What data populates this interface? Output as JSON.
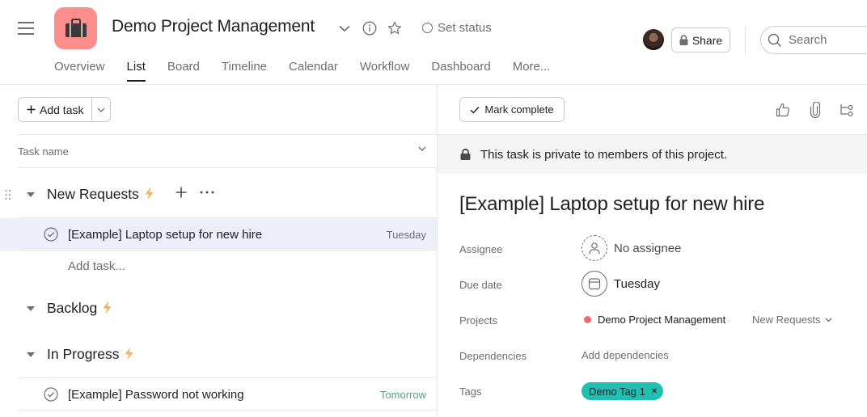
{
  "header": {
    "project_title": "Demo Project Management",
    "project_color": "#fc8f8c",
    "set_status_label": "Set status",
    "share_label": "Share",
    "search_placeholder": "Search",
    "tabs": [
      {
        "label": "Overview",
        "active": false
      },
      {
        "label": "List",
        "active": true
      },
      {
        "label": "Board",
        "active": false
      },
      {
        "label": "Timeline",
        "active": false
      },
      {
        "label": "Calendar",
        "active": false
      },
      {
        "label": "Workflow",
        "active": false
      },
      {
        "label": "Dashboard",
        "active": false
      },
      {
        "label": "More...",
        "active": false
      }
    ]
  },
  "list": {
    "add_task_label": "Add task",
    "column_header": "Task name",
    "sections": [
      {
        "name": "New Requests"
      },
      {
        "name": "Backlog"
      },
      {
        "name": "In Progress"
      }
    ],
    "tasks": [
      {
        "name": "[Example] Laptop setup for new hire",
        "due": "Tuesday",
        "section": "New Requests",
        "selected": true
      },
      {
        "name": "[Example] Password not working",
        "due": "Tomorrow",
        "section": "In Progress",
        "selected": false
      }
    ],
    "add_task_inline": "Add task..."
  },
  "detail": {
    "mark_complete_label": "Mark complete",
    "private_notice": "This task is private to members of this project.",
    "title": "[Example] Laptop setup for new hire",
    "fields": {
      "assignee_label": "Assignee",
      "assignee_value": "No assignee",
      "due_label": "Due date",
      "due_value": "Tuesday",
      "projects_label": "Projects",
      "project_name": "Demo Project Management",
      "project_section": "New Requests",
      "dependencies_label": "Dependencies",
      "dependencies_action": "Add dependencies",
      "tags_label": "Tags",
      "tags": [
        "Demo Tag 1"
      ]
    },
    "tag_color": "#1fbfb1",
    "due_soon_color": "#58a182"
  }
}
